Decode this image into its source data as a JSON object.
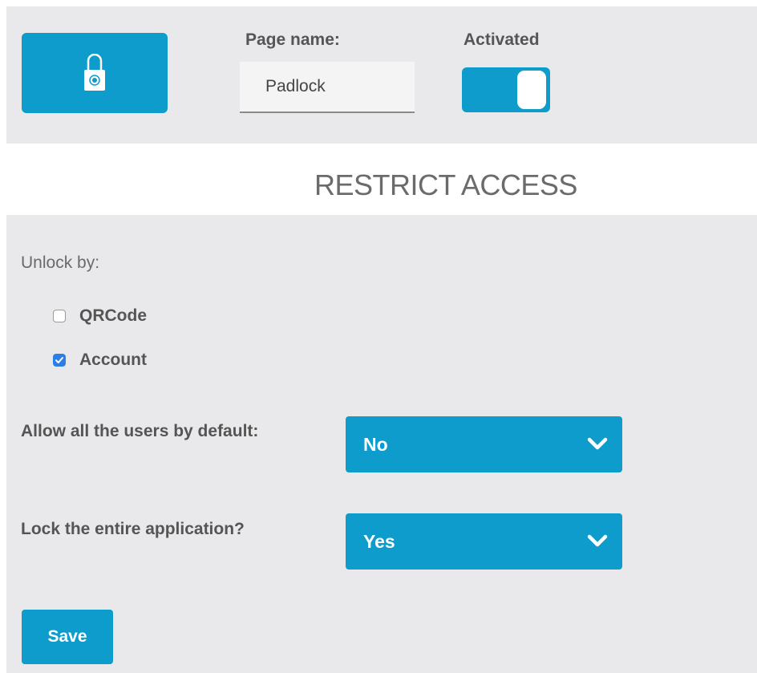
{
  "header": {
    "icon": "padlock-icon",
    "page_name_label": "Page name:",
    "page_name_value": "Padlock",
    "activated_label": "Activated",
    "activated": true
  },
  "section_title": "RESTRICT ACCESS",
  "unlock": {
    "label": "Unlock by:",
    "options": [
      {
        "label": "QRCode",
        "checked": false
      },
      {
        "label": "Account",
        "checked": true
      }
    ]
  },
  "allow_all_users": {
    "label": "Allow all the users by default:",
    "value": "No"
  },
  "lock_entire_app": {
    "label": "Lock the entire application?",
    "value": "Yes"
  },
  "save_label": "Save",
  "colors": {
    "accent": "#0d9ccb",
    "panel": "#e9e9eb",
    "checkbox_checked": "#2d7fe8"
  }
}
